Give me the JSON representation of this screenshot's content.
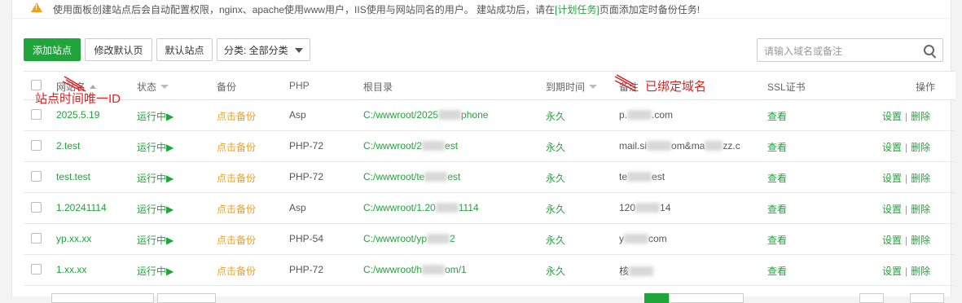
{
  "notice": {
    "text_before": "使用面板创建站点后会自动配置权限，nginx、apache使用www用户，IIS使用与网站同名的用户。 建站成功后，请在",
    "link": "[计划任务]",
    "text_after": "页面添加定时备份任务!"
  },
  "toolbar": {
    "add_site": "添加站点",
    "edit_default_page": "修改默认页",
    "default_site": "默认站点",
    "category": "分类: 全部分类",
    "search_placeholder": "请输入域名或备注"
  },
  "columns": {
    "site_name": "网站名",
    "status": "状态",
    "backup": "备份",
    "php": "PHP",
    "root": "根目录",
    "expire": "到期时间",
    "remark": "备注",
    "ssl": "SSL证书",
    "actions": "操作"
  },
  "annotations": {
    "left": "站点时间唯一ID",
    "right": "已绑定域名"
  },
  "rows": [
    {
      "name": "2025.5.19",
      "status": "运行中▶",
      "backup": "点击备份",
      "php": "Asp",
      "root": "C:/wwwroot/2025",
      "root_tail": "phone",
      "expire": "永久",
      "remark": "p.",
      "remark_tail": ".com",
      "ssl": "查看",
      "set": "设置",
      "del": "删除"
    },
    {
      "name": "2.test",
      "status": "运行中▶",
      "backup": "点击备份",
      "php": "PHP-72",
      "root": "C:/wwwroot/2",
      "root_tail": "est",
      "expire": "永久",
      "remark": "mail.si",
      "remark_tail": "om&ma",
      "remark_tail2": "zz.c",
      "ssl": "查看",
      "set": "设置",
      "del": "删除"
    },
    {
      "name": "test.test",
      "status": "运行中▶",
      "backup": "点击备份",
      "php": "PHP-72",
      "root": "C:/wwwroot/te",
      "root_tail": "est",
      "expire": "永久",
      "remark": "te",
      "remark_tail": "est",
      "ssl": "查看",
      "set": "设置",
      "del": "删除"
    },
    {
      "name": "1.20241114",
      "status": "运行中▶",
      "backup": "点击备份",
      "php": "Asp",
      "root": "C:/wwwroot/1.20",
      "root_tail": "1114",
      "expire": "永久",
      "remark": "120",
      "remark_tail": "14",
      "ssl": "查看",
      "set": "设置",
      "del": "删除"
    },
    {
      "name": "yp.xx.xx",
      "status": "运行中▶",
      "backup": "点击备份",
      "php": "PHP-54",
      "root": "C:/wwwroot/yp",
      "root_tail": "2",
      "expire": "永久",
      "remark": "y",
      "remark_tail": "com",
      "ssl": "查看",
      "set": "设置",
      "del": "删除"
    },
    {
      "name": "1.xx.xx",
      "status": "运行中▶",
      "backup": "点击备份",
      "php": "PHP-72",
      "root": "C:/wwwroot/h",
      "root_tail": "om/1",
      "expire": "永久",
      "remark": "核",
      "remark_tail": "",
      "ssl": "查看",
      "set": "设置",
      "del": "删除"
    }
  ]
}
